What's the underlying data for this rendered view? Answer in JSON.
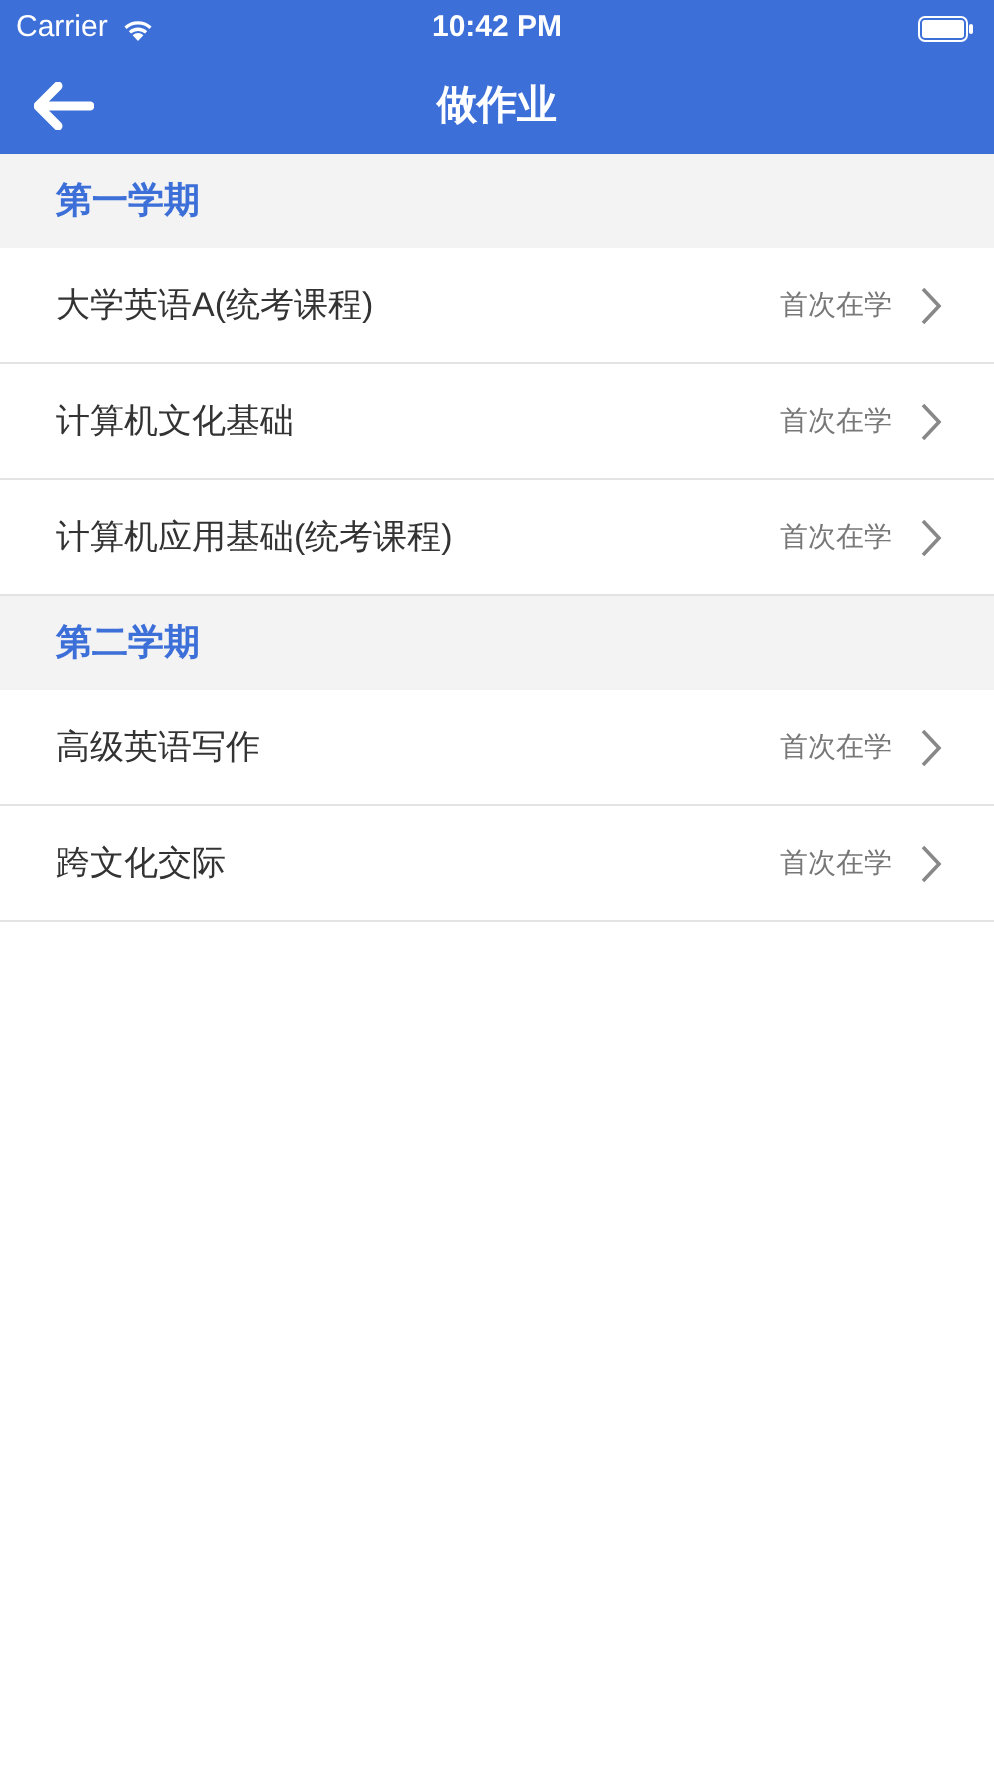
{
  "status_bar": {
    "carrier": "Carrier",
    "time": "10:42 PM"
  },
  "nav_bar": {
    "title": "做作业"
  },
  "sections": [
    {
      "title": "第一学期",
      "items": [
        {
          "name": "大学英语A(统考课程)",
          "status": "首次在学"
        },
        {
          "name": "计算机文化基础",
          "status": "首次在学"
        },
        {
          "name": "计算机应用基础(统考课程)",
          "status": "首次在学"
        }
      ]
    },
    {
      "title": "第二学期",
      "items": [
        {
          "name": "高级英语写作",
          "status": "首次在学"
        },
        {
          "name": "跨文化交际",
          "status": "首次在学"
        }
      ]
    }
  ]
}
